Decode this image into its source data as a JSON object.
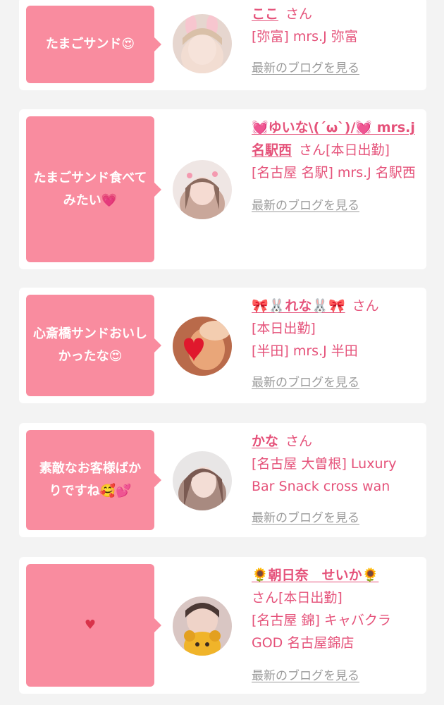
{
  "cards": [
    {
      "comment": "たまごサンド😍",
      "name": "ここ",
      "honorific": "さん",
      "status": "",
      "shop": "[弥富] mrs.J 弥富",
      "blog_link": "最新のブログを見る"
    },
    {
      "comment": "たまごサンド食べてみたい💗",
      "name": "💓ゆいな\\(´ω`)/💓 mrs.j名駅西",
      "honorific": "さん",
      "status": "[本日出勤]",
      "shop": "[名古屋 名駅] mrs.J 名駅西",
      "blog_link": "最新のブログを見る"
    },
    {
      "comment": "心斎橋サンドおいしかったな😍",
      "name": "🎀🐰れな🐰🎀",
      "honorific": "さん",
      "status": "[本日出勤]",
      "shop": "[半田] mrs.J 半田",
      "blog_link": "最新のブログを見る"
    },
    {
      "comment": "素敵なお客様ばかりですね🥰💕",
      "name": "かな",
      "honorific": "さん",
      "status": "",
      "shop": "[名古屋 大曽根] Luxury Bar Snack cross wan",
      "blog_link": "最新のブログを見る"
    },
    {
      "comment": "♥",
      "name": "🌻朝日奈　せいか🌻",
      "honorific": "さん",
      "status": "[本日出勤]",
      "shop": "[名古屋 錦] キャバクラGOD 名古屋錦店",
      "blog_link": "最新のブログを見る"
    }
  ],
  "colors": {
    "page_bg": "#f3f3f3",
    "bubble": "#f98c9f",
    "accent_text": "#e5527a",
    "link_gray": "#9a9a9a"
  }
}
